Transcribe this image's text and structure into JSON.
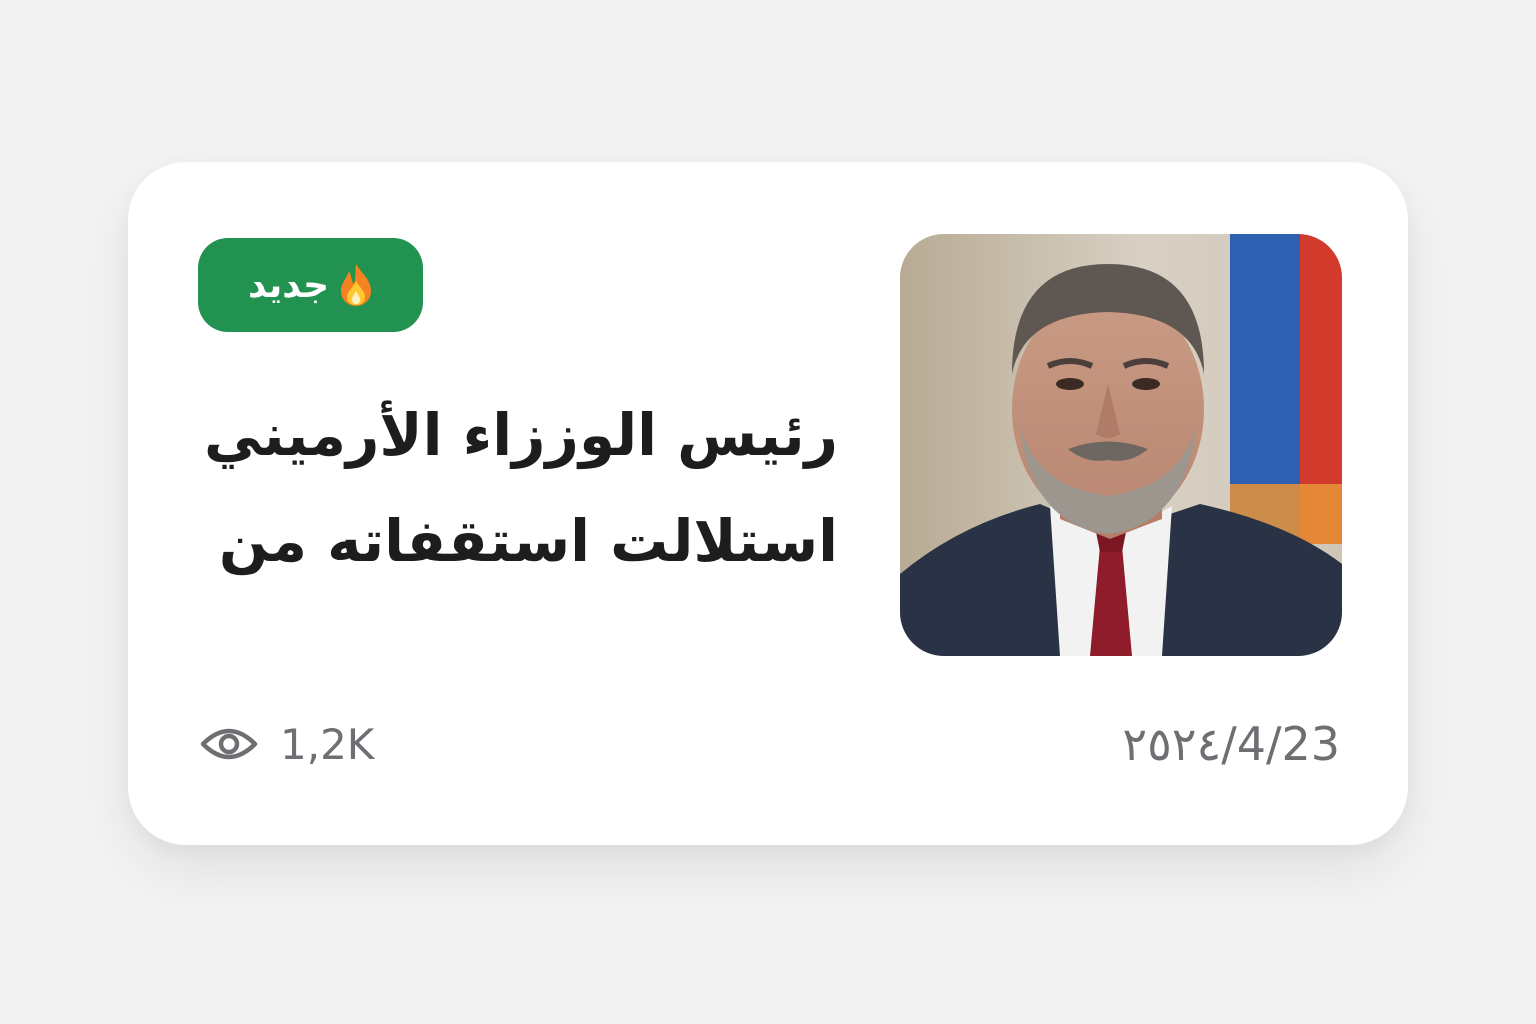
{
  "card": {
    "badge": {
      "icon": "flame-icon",
      "label": "جديد",
      "color": "#229250"
    },
    "headline": "رئيس الوززاء الأرميني استلالت استقفاته من",
    "photo": {
      "alt": "portrait"
    },
    "views": {
      "icon": "eye-icon",
      "count": "1,2K"
    },
    "date": "٢٥٢٤/4/23"
  }
}
